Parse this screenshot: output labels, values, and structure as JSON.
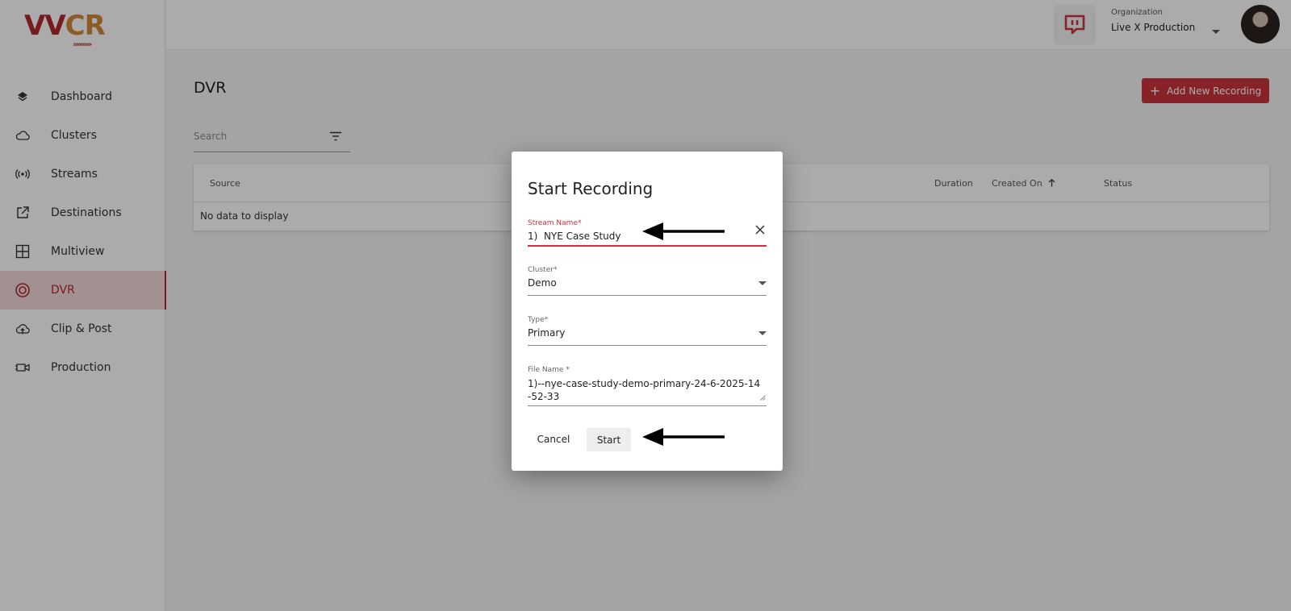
{
  "brand": {
    "logo_text_red": "VV",
    "logo_text_orange": "CR",
    "logo_chevrons": "»»»»»",
    "accent": "#c8333d"
  },
  "sidebar": {
    "items": [
      {
        "label": "Dashboard",
        "icon": "layers-icon"
      },
      {
        "label": "Clusters",
        "icon": "cloud-icon"
      },
      {
        "label": "Streams",
        "icon": "broadcast-icon"
      },
      {
        "label": "Destinations",
        "icon": "external-link-icon"
      },
      {
        "label": "Multiview",
        "icon": "grid-icon"
      },
      {
        "label": "DVR",
        "icon": "target-icon",
        "active": true
      },
      {
        "label": "Clip & Post",
        "icon": "cloud-upload-icon"
      },
      {
        "label": "Production",
        "icon": "video-camera-icon"
      }
    ]
  },
  "topbar": {
    "org_label": "Organization",
    "org_value": "Live X Production"
  },
  "main": {
    "title": "DVR",
    "add_button": "Add New Recording",
    "search_placeholder": "Search",
    "table": {
      "columns": [
        "Source",
        "Duration",
        "Created On",
        "Status"
      ],
      "empty_text": "No data to display"
    }
  },
  "dialog": {
    "title": "Start Recording",
    "stream_name_label": "Stream Name*",
    "stream_name_value": "1)  NYE Case Study",
    "cluster_label": "Cluster*",
    "cluster_value": "Demo",
    "type_label": "Type*",
    "type_value": "Primary",
    "file_name_label": "File Name *",
    "file_name_value": "1)--nye-case-study-demo-primary-24-6-2025-14-52-33",
    "cancel_label": "Cancel",
    "start_label": "Start"
  }
}
